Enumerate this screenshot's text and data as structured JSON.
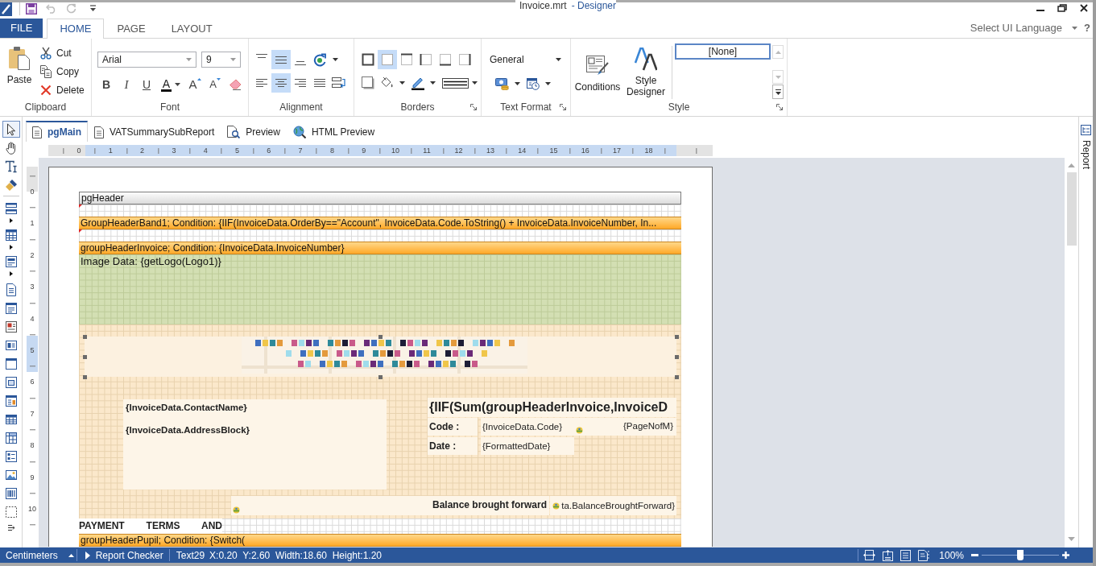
{
  "title_bar": {
    "document": "Invoice.mrt",
    "app": "- Designer"
  },
  "ribbon_tabs": [
    {
      "label": "FILE",
      "kind": "backstage",
      "selected": false
    },
    {
      "label": "HOME",
      "kind": "tab",
      "selected": true
    },
    {
      "label": "PAGE",
      "kind": "tab",
      "selected": false
    },
    {
      "label": "LAYOUT",
      "kind": "tab",
      "selected": false
    }
  ],
  "language_menu": {
    "label": "Select UI Language"
  },
  "help": "?",
  "ribbon": {
    "clipboard": {
      "label": "Clipboard",
      "paste": "Paste",
      "actions": [
        {
          "kind": "cut",
          "label": "Cut"
        },
        {
          "kind": "copy",
          "label": "Copy"
        },
        {
          "kind": "delete",
          "label": "Delete"
        }
      ]
    },
    "font": {
      "label": "Font",
      "family": "Arial",
      "size": "9",
      "buttons": [
        {
          "kind": "bold",
          "glyph": "B"
        },
        {
          "kind": "italic",
          "glyph": "I"
        },
        {
          "kind": "underline",
          "glyph": "U"
        },
        {
          "kind": "color",
          "glyph": "A"
        },
        {
          "kind": "grow",
          "glyph": "A"
        },
        {
          "kind": "shrink",
          "glyph": "A"
        },
        {
          "kind": "clear"
        }
      ]
    },
    "alignment": {
      "label": "Alignment",
      "vertical": [
        {
          "kind": "top",
          "selected": false
        },
        {
          "kind": "middle",
          "selected": true
        },
        {
          "kind": "bottom",
          "selected": false
        }
      ],
      "horizontal": [
        {
          "kind": "left",
          "selected": false
        },
        {
          "kind": "center",
          "selected": true
        },
        {
          "kind": "right",
          "selected": false
        },
        {
          "kind": "justify",
          "selected": false
        }
      ]
    },
    "borders": {
      "label": "Borders",
      "sides": [
        {
          "kind": "all",
          "selected": false
        },
        {
          "kind": "none",
          "selected": true
        },
        {
          "kind": "top",
          "selected": false
        },
        {
          "kind": "left",
          "selected": false
        },
        {
          "kind": "bottom",
          "selected": false
        },
        {
          "kind": "right",
          "selected": false
        }
      ]
    },
    "text_format": {
      "label": "Text Format",
      "format": "General"
    },
    "style": {
      "label": "Style",
      "conditions": "Conditions",
      "designer": "Style Designer",
      "gallery": [
        {
          "label": "[None]",
          "selected": true
        }
      ]
    }
  },
  "toolbox": {
    "tools": [
      {
        "kind": "pointer",
        "selected": true
      },
      {
        "kind": "hand",
        "selected": false
      },
      {
        "kind": "textedit",
        "selected": false
      },
      {
        "kind": "painter",
        "selected": false
      }
    ],
    "components": [
      {
        "kind": "bands",
        "selected": false
      },
      {
        "kind": "databands",
        "selected": false
      },
      {
        "kind": "crossbands",
        "selected": false
      },
      {
        "kind": "text",
        "selected": false
      },
      {
        "kind": "richtext",
        "selected": false
      },
      {
        "kind": "textbox",
        "selected": false
      },
      {
        "kind": "label",
        "selected": false
      },
      {
        "kind": "panel",
        "selected": false
      },
      {
        "kind": "clone",
        "selected": false
      },
      {
        "kind": "subreport",
        "selected": false
      },
      {
        "kind": "table",
        "selected": false
      },
      {
        "kind": "crosstab",
        "selected": false
      },
      {
        "kind": "textlist",
        "selected": false
      },
      {
        "kind": "image",
        "selected": false
      },
      {
        "kind": "barcode",
        "selected": false
      },
      {
        "kind": "shape",
        "selected": false
      }
    ]
  },
  "page_tabs": [
    {
      "label": "pgMain",
      "kind": "page",
      "selected": true
    },
    {
      "label": "VATSummarySubReport",
      "kind": "page",
      "selected": false
    },
    {
      "label": "Preview",
      "kind": "preview",
      "selected": false
    },
    {
      "label": "HTML Preview",
      "kind": "web",
      "selected": false
    }
  ],
  "rulers": {
    "horizontal": [
      "0",
      "1",
      "2",
      "3",
      "4",
      "5",
      "6",
      "7",
      "8",
      "9",
      "10",
      "11",
      "12",
      "13",
      "14",
      "15",
      "16",
      "17",
      "18"
    ],
    "vertical": [
      "0",
      "1",
      "2",
      "3",
      "4",
      "5",
      "6",
      "7",
      "8",
      "9",
      "10"
    ]
  },
  "side_panel": {
    "label": "Report"
  },
  "report": {
    "bands": [
      {
        "kind": "pageheader",
        "title": "pgHeader",
        "body": {
          "kind": "blank"
        }
      },
      {
        "kind": "groupheader",
        "title": "GroupHeaderBand1; Condition: {IIF(InvoiceData.OrderBy==\"Account\", InvoiceData.Code.ToString() + InvoiceData.InvoiceNumber, In...",
        "body": {
          "kind": "blank"
        }
      },
      {
        "kind": "groupheader",
        "title": "groupHeaderInvoice; Condition: {InvoiceData.InvoiceNumber}",
        "body": {
          "kind": "invoice",
          "image": "Image Data: {getLogo(Logo1)}",
          "contact": [
            "{InvoiceData.ContactName}",
            "{InvoiceData.AddressBlock}"
          ],
          "title": "{IIF(Sum(groupHeaderInvoice,InvoiceD",
          "fields": [
            {
              "label": "Code :",
              "value": "{InvoiceData.Code}"
            },
            {
              "label": "Date :",
              "value": "{FormattedDate}"
            }
          ],
          "page_number": "{PageNofM}",
          "balance": {
            "label": "Balance brought forward",
            "value": "ta.BalanceBroughtForward}"
          },
          "terms": "PAYMENT TERMS AND"
        }
      },
      {
        "kind": "groupheader",
        "title": "groupHeaderPupil; Condition: {Switch("
      }
    ]
  },
  "status_bar": {
    "units": "Centimeters",
    "checker": "Report Checker",
    "component": "Text29",
    "geometry": "X:0.20  Y:2.60  Width:18.60  Height:1.20",
    "zoom": "100%",
    "zoom_slider": {
      "level": 0.5
    }
  }
}
